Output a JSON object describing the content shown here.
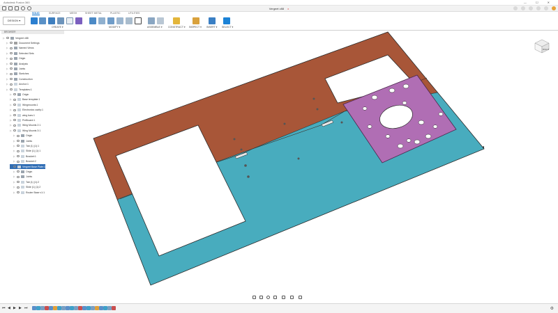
{
  "app": {
    "title": "Autodesk Fusion 360",
    "window_controls": "— ☐ ✕"
  },
  "document": {
    "tab_title": "Vergeet v88",
    "close_glyph": "x"
  },
  "toolbar": {
    "workspace": "DESIGN ▾",
    "tabs": [
      "SOLID",
      "SURFACE",
      "MESH",
      "SHEET METAL",
      "PLASTIC",
      "UTILITIES"
    ],
    "active_tab": "SOLID",
    "groups": {
      "create": "CREATE ▾",
      "modify": "MODIFY ▾",
      "assemble": "ASSEMBLE ▾",
      "construct": "CONSTRUCT ▾",
      "inspect": "INSPECT ▾",
      "insert": "INSERT ▾",
      "select": "SELECT ▾"
    }
  },
  "browser": {
    "header": "BROWSER",
    "items": [
      {
        "label": "Vergeet v88",
        "indent": 0,
        "kind": "root"
      },
      {
        "label": "Document Settings",
        "indent": 1,
        "kind": "gear"
      },
      {
        "label": "Named Views",
        "indent": 1,
        "kind": "folder"
      },
      {
        "label": "Selected Sets",
        "indent": 1,
        "kind": "folder"
      },
      {
        "label": "Origin",
        "indent": 1,
        "kind": "folder"
      },
      {
        "label": "Analysis",
        "indent": 1,
        "kind": "folder"
      },
      {
        "label": "Joints",
        "indent": 1,
        "kind": "folder"
      },
      {
        "label": "Sketches",
        "indent": 1,
        "kind": "folder"
      },
      {
        "label": "Construction",
        "indent": 1,
        "kind": "folder"
      },
      {
        "label": "Anchor:1",
        "indent": 1,
        "kind": "comp"
      },
      {
        "label": "Templates:1",
        "indent": 1,
        "kind": "comp"
      },
      {
        "label": "Origin",
        "indent": 2,
        "kind": "folder"
      },
      {
        "label": "Base template:1",
        "indent": 2,
        "kind": "comp"
      },
      {
        "label": "Wingmounts:1",
        "indent": 2,
        "kind": "comp"
      },
      {
        "label": "Electronics cavity:1",
        "indent": 2,
        "kind": "comp"
      },
      {
        "label": "wing bars:1",
        "indent": 2,
        "kind": "comp"
      },
      {
        "label": "Prefboard:1",
        "indent": 2,
        "kind": "comp"
      },
      {
        "label": "Wing Mounts 2:1",
        "indent": 2,
        "kind": "comp"
      },
      {
        "label": "Wing Mounts 3:1",
        "indent": 2,
        "kind": "comp"
      },
      {
        "label": "Origin",
        "indent": 3,
        "kind": "folder"
      },
      {
        "label": "Joints",
        "indent": 3,
        "kind": "folder"
      },
      {
        "label": "Tab (1) (1):1",
        "indent": 3,
        "kind": "comp"
      },
      {
        "label": "Slide (1) (1):1",
        "indent": 3,
        "kind": "comp"
      },
      {
        "label": "Bracket:1",
        "indent": 3,
        "kind": "comp"
      },
      {
        "label": "Bracket:2",
        "indent": 3,
        "kind": "comp"
      },
      {
        "label": "Vergeet Base Plate:1",
        "indent": 2,
        "kind": "comp",
        "selected": true
      },
      {
        "label": "Origin",
        "indent": 3,
        "kind": "folder"
      },
      {
        "label": "Joints",
        "indent": 3,
        "kind": "folder"
      },
      {
        "label": "Tab (1) (1):2",
        "indent": 3,
        "kind": "comp"
      },
      {
        "label": "Slide (1) (1):2",
        "indent": 3,
        "kind": "comp"
      },
      {
        "label": "Router Base v1:1",
        "indent": 3,
        "kind": "comp"
      }
    ]
  },
  "viewcube": {
    "label": "RIGHT"
  },
  "colors": {
    "orange_plate": "#a85638",
    "teal_plate": "#48acbe",
    "purple_plate": "#b06eb4",
    "accent": "#0b6fc9",
    "selection": "#2f6db5"
  },
  "icons": {
    "timeline_controls": [
      "skip-start-icon",
      "step-back-icon",
      "play-icon",
      "step-forward-icon",
      "skip-end-icon"
    ],
    "nav_bar": [
      "orbit-icon",
      "pan-icon",
      "zoom-icon",
      "fit-icon",
      "display-settings-icon",
      "grid-icon",
      "viewport-icon"
    ]
  }
}
